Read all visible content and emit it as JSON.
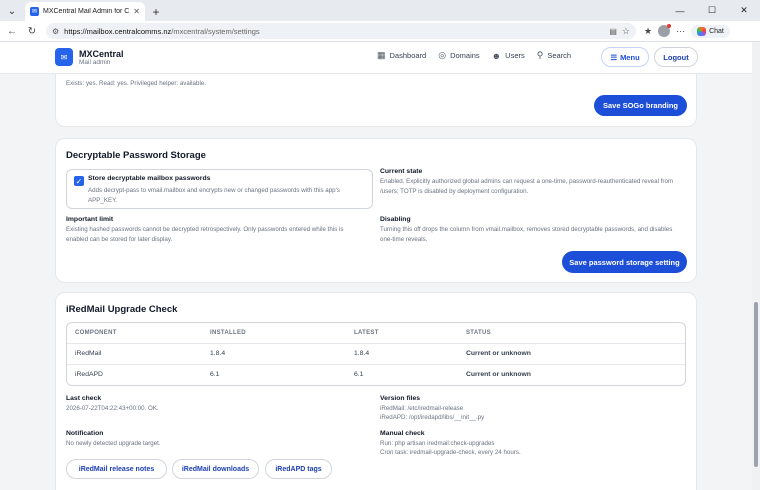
{
  "browser": {
    "tab_title": "MXCentral Mail Admin for CCL",
    "url_host": "https://mailbox.centralcomms.nz",
    "url_path": "/mxcentral/system/settings",
    "chat_label": "Chat"
  },
  "app": {
    "brand_name": "MXCentral",
    "brand_sub": "Mail admin",
    "nav": [
      {
        "label": "Dashboard",
        "icon": "dashboard-icon"
      },
      {
        "label": "Domains",
        "icon": "globe-icon"
      },
      {
        "label": "Users",
        "icon": "users-icon"
      },
      {
        "label": "Search",
        "icon": "search-icon"
      }
    ],
    "menu_label": "Menu",
    "logout_label": "Logout"
  },
  "sogo": {
    "status_text": "Exists: yes. Read: yes. Privileged helper: available.",
    "save_label": "Save SOGo branding"
  },
  "password_storage": {
    "title": "Decryptable Password Storage",
    "checkbox_label": "Store decryptable mailbox passwords",
    "checkbox_desc": "Adds decrypt-pass to vmail.mailbox and encrypts new or changed passwords with this app's APP_KEY.",
    "current_state_label": "Current state",
    "current_state_text": "Enabled. Explicitly authorized global admins can request a one-time, password-reauthenticated reveal from /users; TOTP is disabled by deployment configuration.",
    "important_limit_label": "Important limit",
    "important_limit_text": "Existing hashed passwords cannot be decrypted retrospectively. Only passwords entered while this is enabled can be stored for later display.",
    "disabling_label": "Disabling",
    "disabling_text": "Turning this off drops the column from vmail.mailbox, removes stored decryptable passwords, and disables one-time reveals.",
    "save_label": "Save password storage setting"
  },
  "upgrade": {
    "title": "iRedMail Upgrade Check",
    "columns": [
      "COMPONENT",
      "INSTALLED",
      "LATEST",
      "STATUS"
    ],
    "rows": [
      {
        "component": "iRedMail",
        "installed": "1.8.4",
        "latest": "1.8.4",
        "status": "Current or unknown"
      },
      {
        "component": "iRedAPD",
        "installed": "6.1",
        "latest": "6.1",
        "status": "Current or unknown"
      }
    ],
    "last_check_label": "Last check",
    "last_check_text": "2026-07-22T04:22:43+00:00. OK.",
    "version_files_label": "Version files",
    "version_files_line1": "iRedMail: /etc/iredmail-release",
    "version_files_line2": "iRedAPD: /opt/iredapd/libs/__init__.py",
    "notification_label": "Notification",
    "notification_text": "No newly detected upgrade target.",
    "manual_check_label": "Manual check",
    "manual_check_line1": "Run: php artisan iredmail:check-upgrades",
    "manual_check_line2": "Cron task: iredmail-upgrade-check, every 24 hours.",
    "links": [
      "iRedMail release notes",
      "iRedMail downloads",
      "iRedAPD tags"
    ]
  }
}
